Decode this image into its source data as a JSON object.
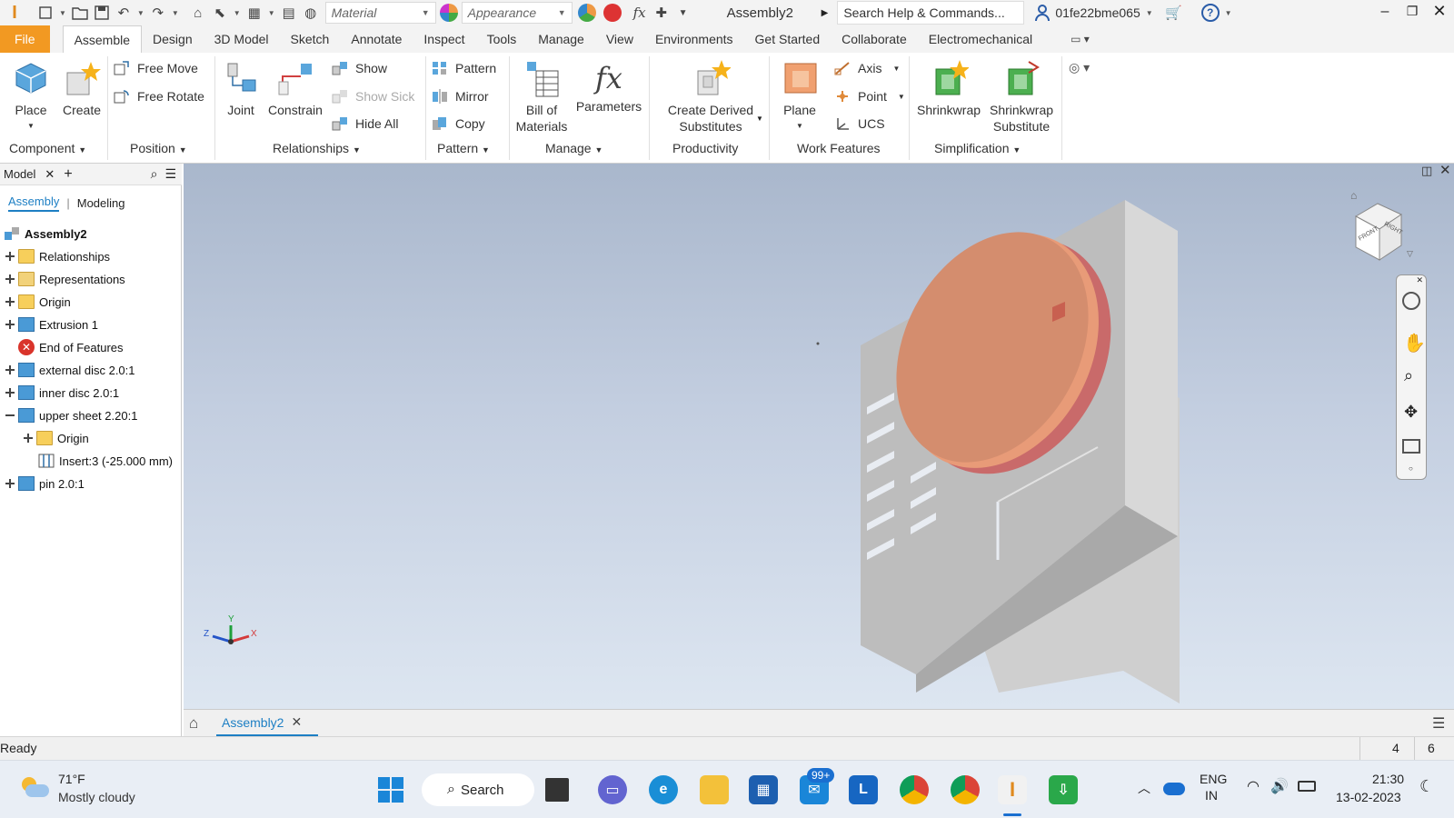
{
  "titlebar": {
    "app_icon": "inventor-logo",
    "material_placeholder": "Material",
    "appearance_placeholder": "Appearance",
    "document_title": "Assembly2",
    "search_placeholder": "Search Help & Commands...",
    "user_name": "01fe22bme065"
  },
  "ribbon_tabs": [
    "File",
    "Assemble",
    "Design",
    "3D Model",
    "Sketch",
    "Annotate",
    "Inspect",
    "Tools",
    "Manage",
    "View",
    "Environments",
    "Get Started",
    "Collaborate",
    "Electromechanical"
  ],
  "active_tab": "Assemble",
  "ribbon": {
    "component": {
      "place": "Place",
      "create": "Create",
      "label": "Component"
    },
    "position": {
      "free_move": "Free Move",
      "free_rotate": "Free Rotate",
      "label": "Position"
    },
    "relationships": {
      "joint": "Joint",
      "constrain": "Constrain",
      "show": "Show",
      "show_sick": "Show Sick",
      "hide_all": "Hide All",
      "label": "Relationships"
    },
    "pattern": {
      "pattern": "Pattern",
      "mirror": "Mirror",
      "copy": "Copy",
      "label": "Pattern"
    },
    "manage": {
      "bom_line1": "Bill of",
      "bom_line2": "Materials",
      "parameters": "Parameters",
      "label": "Manage"
    },
    "productivity": {
      "line1": "Create Derived",
      "line2": "Substitutes",
      "label": "Productivity"
    },
    "work_features": {
      "plane": "Plane",
      "axis": "Axis",
      "point": "Point",
      "ucs": "UCS",
      "label": "Work Features"
    },
    "simplification": {
      "shrinkwrap": "Shrinkwrap",
      "sub_line1": "Shrinkwrap",
      "sub_line2": "Substitute",
      "label": "Simplification"
    }
  },
  "browser": {
    "tab_model": "Model",
    "sub_assembly": "Assembly",
    "sub_modeling": "Modeling",
    "root": "Assembly2",
    "items": [
      {
        "label": "Relationships",
        "icon": "folder-icon"
      },
      {
        "label": "Representations",
        "icon": "representations-icon"
      },
      {
        "label": "Origin",
        "icon": "folder-icon"
      },
      {
        "label": "Extrusion 1",
        "icon": "extrusion-icon"
      },
      {
        "label": "End of Features",
        "icon": "end-of-features-icon"
      },
      {
        "label": "external disc 2.0:1",
        "icon": "part-icon"
      },
      {
        "label": "inner disc 2.0:1",
        "icon": "part-icon"
      },
      {
        "label": "upper sheet 2.20:1",
        "icon": "part-icon"
      },
      {
        "label": "Origin",
        "icon": "folder-icon"
      },
      {
        "label": "Insert:3 (-25.000 mm)",
        "icon": "insert-constraint-icon"
      },
      {
        "label": "pin 2.0:1",
        "icon": "part-icon"
      }
    ]
  },
  "viewcube": {
    "front": "FRONT",
    "right": "RIGHT"
  },
  "triad": {
    "x": "X",
    "y": "Y",
    "z": "Z"
  },
  "doc_tab": "Assembly2",
  "status": {
    "text": "Ready",
    "count1": "4",
    "count2": "6"
  },
  "taskbar": {
    "weather_temp": "71°F",
    "weather_desc": "Mostly cloudy",
    "search_label": "Search",
    "mail_badge": "99+",
    "lang1": "ENG",
    "lang2": "IN",
    "time": "21:30",
    "date": "13-02-2023"
  },
  "colors": {
    "file_tab": "#f29922",
    "disc_face": "#d48d6e",
    "disc_edge": "#c96a6a",
    "sheet": "#bdbdbd",
    "accent_blue": "#1d7fc4"
  }
}
